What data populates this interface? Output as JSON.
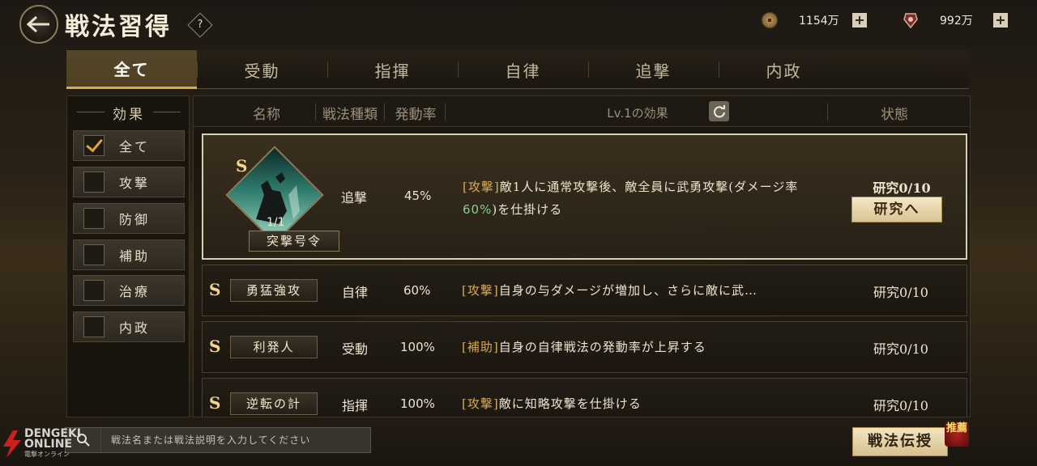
{
  "header": {
    "title": "戦法習得",
    "help_label": "?",
    "currency_coins": "1154万",
    "currency_gems": "992万",
    "plus_label": "+"
  },
  "tabs": [
    {
      "label": "全て",
      "active": true
    },
    {
      "label": "受動",
      "active": false
    },
    {
      "label": "指揮",
      "active": false
    },
    {
      "label": "自律",
      "active": false
    },
    {
      "label": "追撃",
      "active": false
    },
    {
      "label": "内政",
      "active": false
    }
  ],
  "filter": {
    "title": "効果",
    "items": [
      {
        "label": "全て",
        "checked": true
      },
      {
        "label": "攻撃",
        "checked": false
      },
      {
        "label": "防御",
        "checked": false
      },
      {
        "label": "補助",
        "checked": false
      },
      {
        "label": "治療",
        "checked": false
      },
      {
        "label": "内政",
        "checked": false
      }
    ]
  },
  "table": {
    "headers": {
      "name": "名称",
      "type": "戦法種類",
      "rate": "発動率",
      "effect": "Lv.1の効果",
      "status": "状態"
    },
    "rows": [
      {
        "grade": "S",
        "name": "突撃号令",
        "level": "1/1",
        "type": "追撃",
        "rate": "45%",
        "tag": "[攻撃]",
        "desc_a": "敵1人に通常攻撃後、敵全員に武勇攻撃(ダメージ率",
        "desc_hl": "60%",
        "desc_b": ")を仕掛ける",
        "status": "研究0/10",
        "button": "研究へ",
        "selected": true
      },
      {
        "grade": "S",
        "name": "勇猛強攻",
        "type": "自律",
        "rate": "60%",
        "tag": "[攻撃]",
        "desc": "自身の与ダメージが増加し、さらに敵に武…",
        "status": "研究0/10"
      },
      {
        "grade": "S",
        "name": "利発人",
        "type": "受動",
        "rate": "100%",
        "tag": "[補助]",
        "desc": "自身の自律戦法の発動率が上昇する",
        "status": "研究0/10"
      },
      {
        "grade": "S",
        "name": "逆転の計",
        "type": "指揮",
        "rate": "100%",
        "tag": "[攻撃]",
        "desc": "敵に知略攻撃を仕掛ける",
        "status": "研究0/10"
      }
    ]
  },
  "search": {
    "placeholder": "戦法名または戦法説明を入力してください"
  },
  "footer": {
    "teach_button": "戦法伝授",
    "recommend_badge": "推薦"
  },
  "watermark": {
    "text_top": "DENGEKI",
    "text_bottom": "ONLINE",
    "sub": "電撃オンライン"
  },
  "colors": {
    "accent_gold": "#d9a94a",
    "highlight_green": "#7fd48a"
  }
}
